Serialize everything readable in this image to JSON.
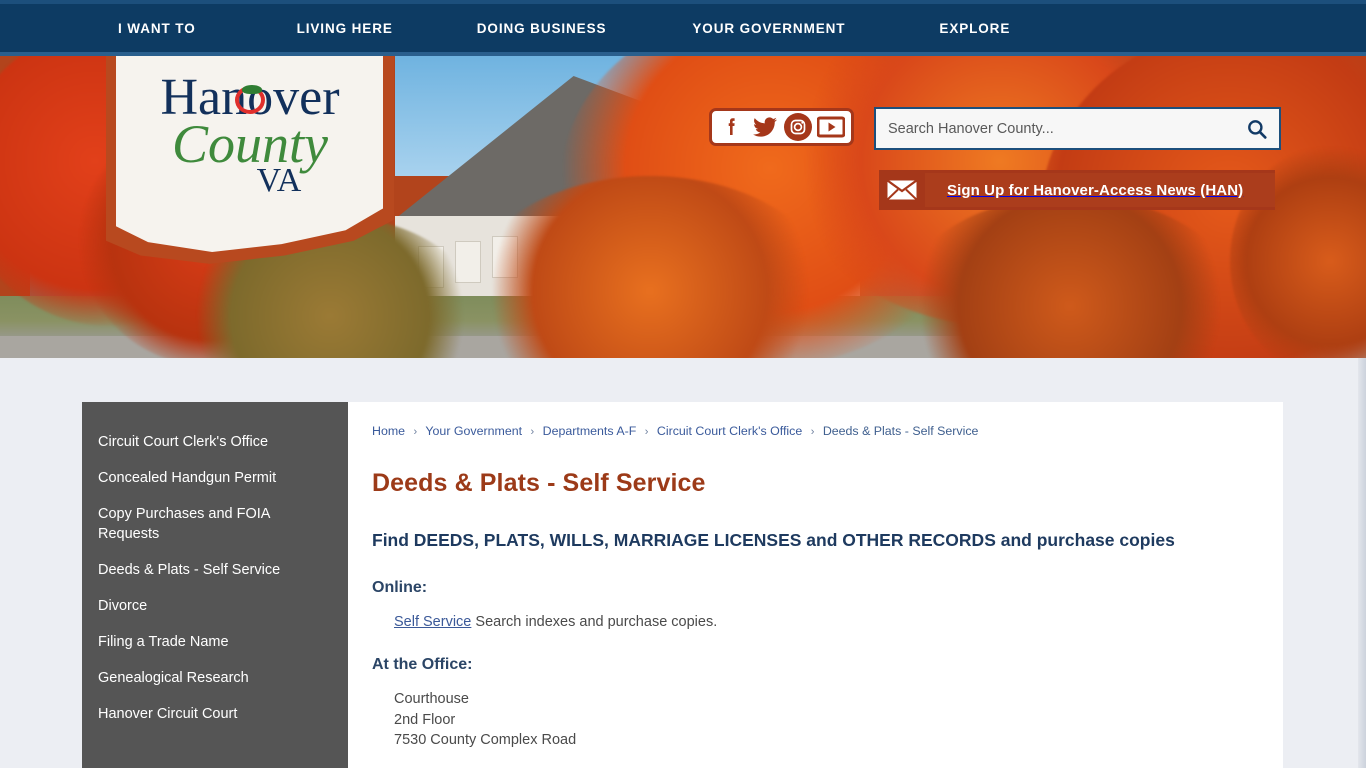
{
  "topnav": {
    "items": [
      {
        "label": "I WANT TO"
      },
      {
        "label": "LIVING HERE"
      },
      {
        "label": "DOING BUSINESS"
      },
      {
        "label": "YOUR GOVERNMENT"
      },
      {
        "label": "EXPLORE"
      }
    ]
  },
  "logo": {
    "line1": "Hanover",
    "line2": "County",
    "line3": "VA",
    "alt": "Hanover County VA"
  },
  "social": {
    "items": [
      {
        "name": "facebook-icon",
        "label": "Facebook"
      },
      {
        "name": "twitter-icon",
        "label": "Twitter"
      },
      {
        "name": "instagram-icon",
        "label": "Instagram"
      },
      {
        "name": "youtube-icon",
        "label": "YouTube"
      }
    ]
  },
  "search": {
    "placeholder": "Search Hanover County...",
    "value": "",
    "button_label": "Search"
  },
  "han_banner": {
    "label": "Sign Up for Hanover-Access News (HAN)"
  },
  "sidebar": {
    "items": [
      {
        "label": "Circuit Court Clerk's Office"
      },
      {
        "label": "Concealed Handgun Permit"
      },
      {
        "label": "Copy Purchases and FOIA Requests"
      },
      {
        "label": "Deeds & Plats - Self Service"
      },
      {
        "label": "Divorce"
      },
      {
        "label": "Filing a Trade Name"
      },
      {
        "label": "Genealogical Research"
      },
      {
        "label": "Hanover Circuit Court"
      }
    ]
  },
  "breadcrumb": {
    "items": [
      {
        "label": "Home"
      },
      {
        "label": "Your Government"
      },
      {
        "label": "Departments A-F"
      },
      {
        "label": "Circuit Court Clerk's Office"
      },
      {
        "label": "Deeds & Plats - Self Service"
      }
    ],
    "separator": "›"
  },
  "main": {
    "title": "Deeds & Plats - Self Service",
    "lede": "Find DEEDS, PLATS, WILLS, MARRIAGE LICENSES and OTHER RECORDS and purchase copies",
    "online_heading": "Online:",
    "online_link": "Self Service",
    "online_text": " Search indexes and purchase copies.",
    "office_heading": "At the Office:",
    "address": [
      "Courthouse",
      "2nd Floor",
      "7530 County Complex Road"
    ]
  },
  "colors": {
    "nav_blue": "#0d3b63",
    "accent_rust": "#a5371a",
    "title_rust": "#9c3a18",
    "sidebar_gray": "#555555",
    "page_bg": "#eceef3",
    "link_blue": "#3b5998"
  }
}
